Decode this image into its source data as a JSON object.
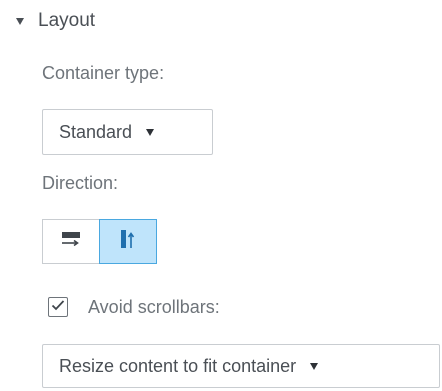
{
  "layout_section": {
    "title": "Layout",
    "expanded_icon": "caret-down-icon",
    "container_type": {
      "label": "Container type:",
      "selected": "Standard"
    },
    "direction": {
      "label": "Direction:",
      "options": [
        {
          "icon": "horizontal-direction-icon",
          "selected": false
        },
        {
          "icon": "vertical-direction-icon",
          "selected": true
        }
      ]
    },
    "avoid_scrollbars": {
      "label": "Avoid scrollbars:",
      "checked": true
    },
    "resize_mode": {
      "selected": "Resize content to fit container"
    }
  },
  "colors": {
    "text": "#4a4f55",
    "muted_text": "#6e747a",
    "border": "#c9cdd1",
    "selected_bg": "#bfe4fb",
    "selected_border": "#4aa8e0",
    "accent_icon": "#1f6fae"
  }
}
